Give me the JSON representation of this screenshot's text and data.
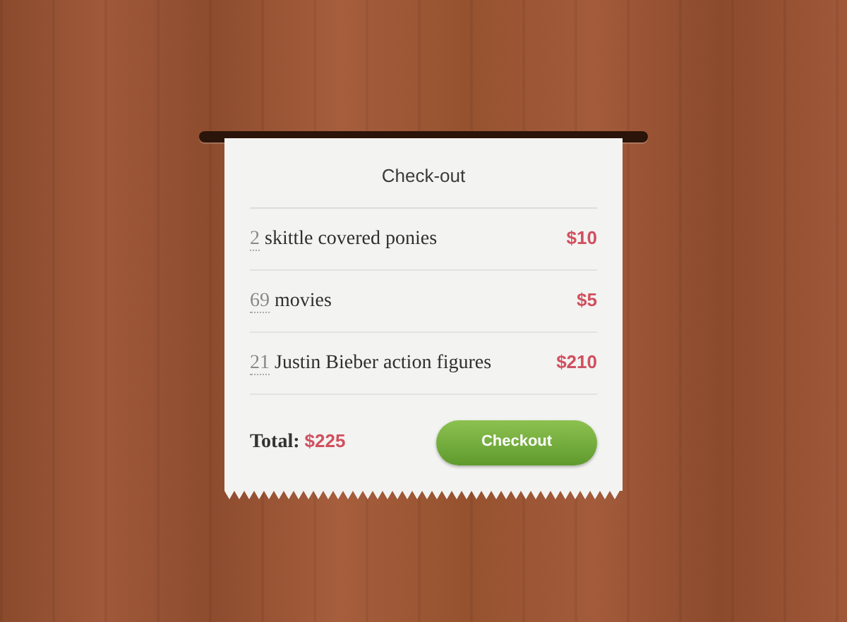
{
  "receipt": {
    "title": "Check-out",
    "items": [
      {
        "quantity": "2",
        "name": "skittle covered ponies",
        "price": "$10"
      },
      {
        "quantity": "69",
        "name": "movies",
        "price": "$5"
      },
      {
        "quantity": "21",
        "name": "Justin Bieber action figures",
        "price": "$210"
      }
    ],
    "total": {
      "label": "Total:",
      "amount": "$225"
    },
    "button": "Checkout"
  }
}
